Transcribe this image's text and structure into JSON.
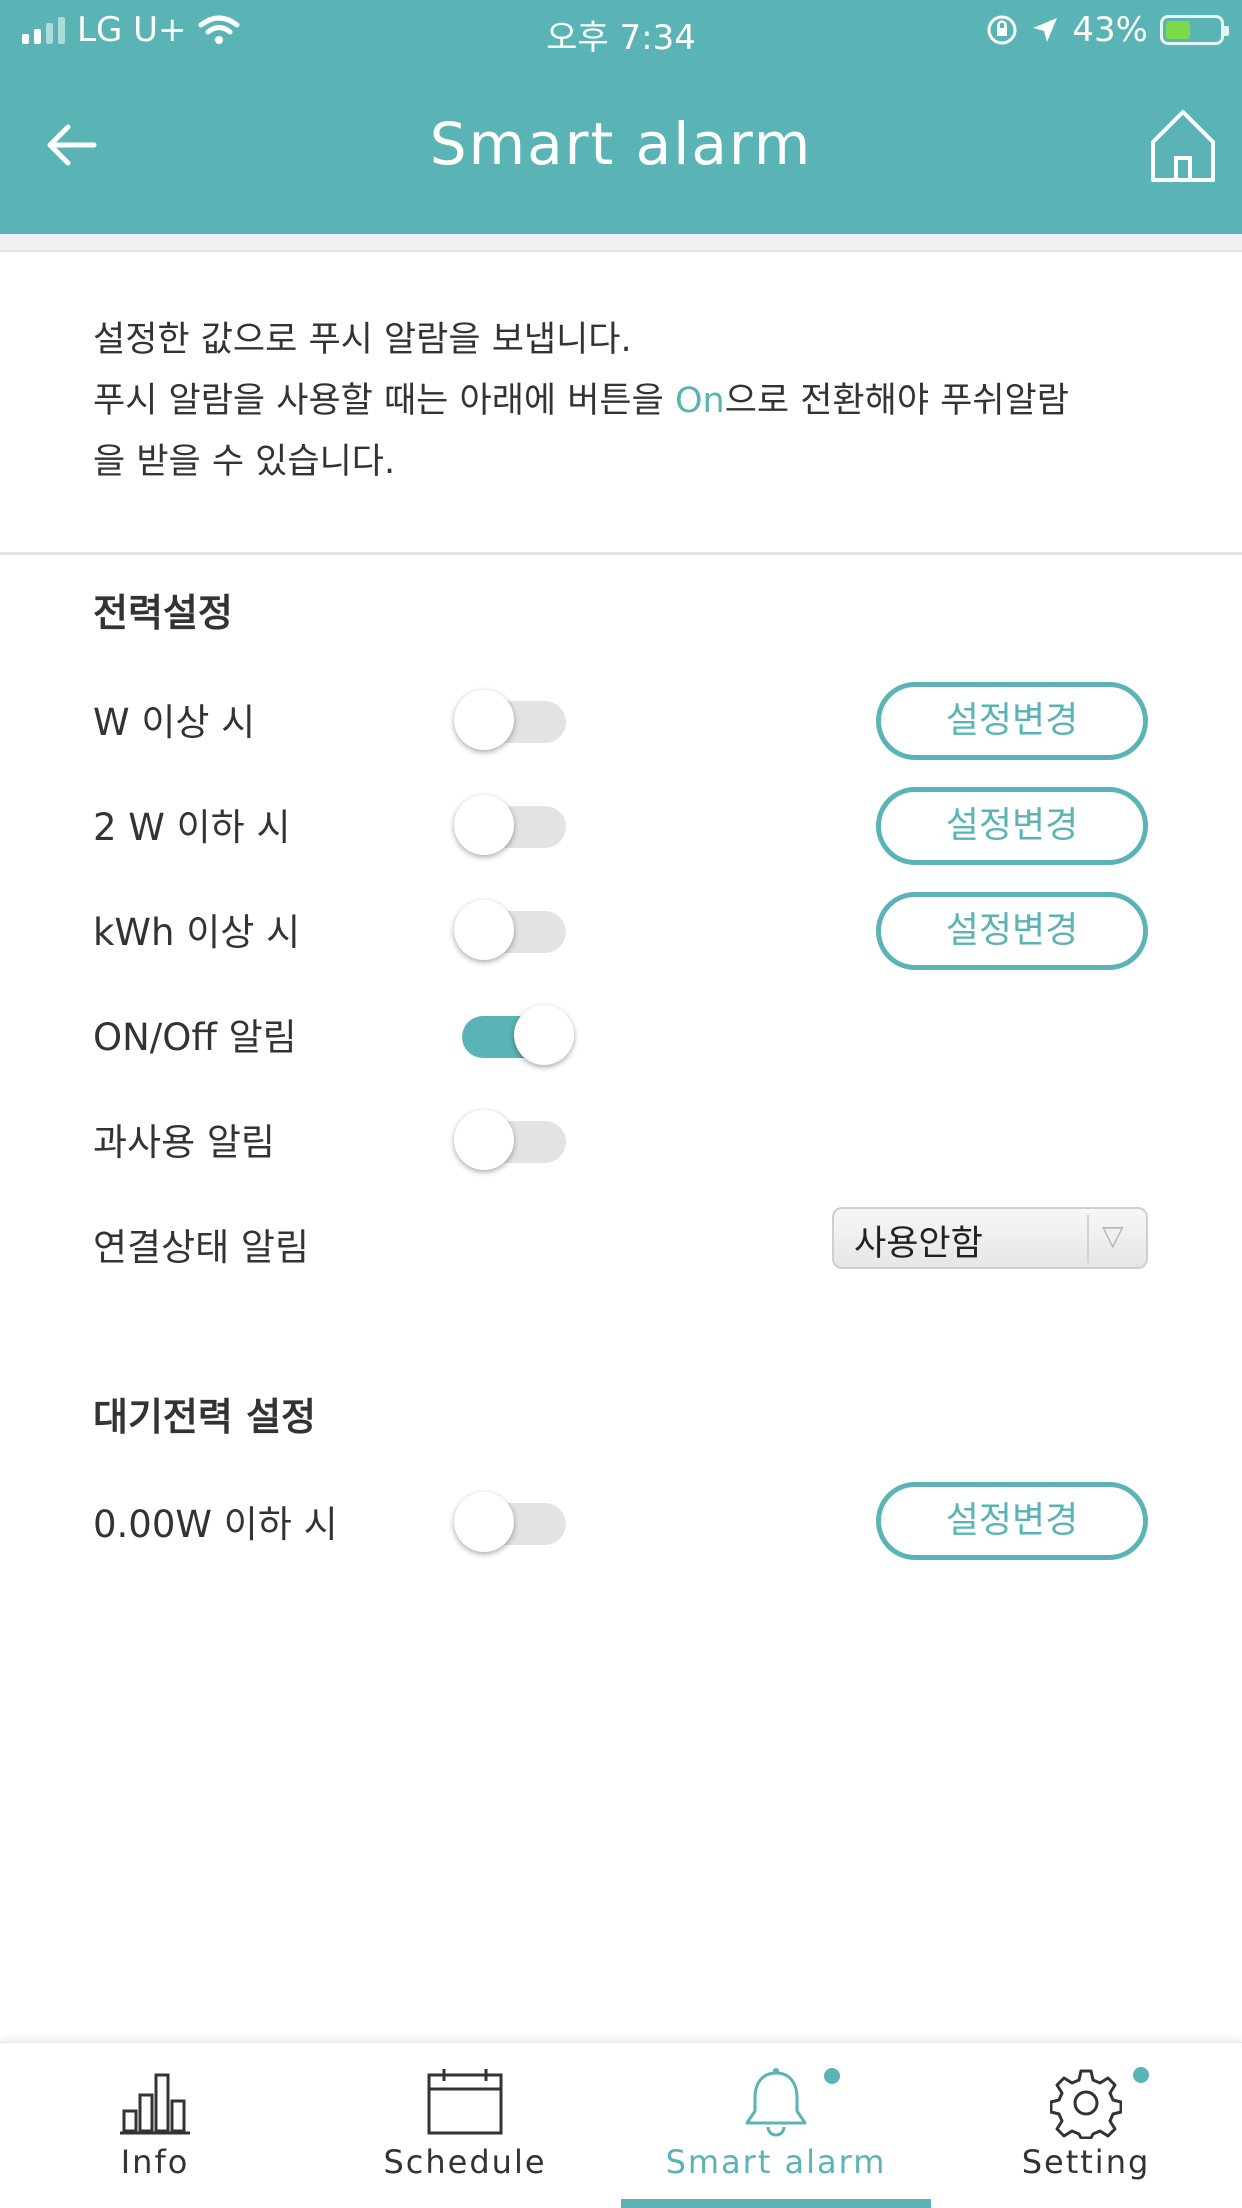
{
  "status_bar": {
    "carrier": "LG U+",
    "time": "오후 7:34",
    "battery": "43%"
  },
  "header": {
    "title": "Smart alarm"
  },
  "intro": {
    "line1": "설정한 값으로 푸시 알람을 보냅니다.",
    "line2_before": "푸시 알람을 사용할 때는 아래에 버튼을 ",
    "line2_highlight": "On",
    "line2_after": "으로 전환해야 푸쉬알람",
    "line3": "을 받을 수 있습니다."
  },
  "power_section": {
    "title": "전력설정",
    "rows": [
      {
        "label": "W 이상 시",
        "toggle_on": false,
        "button": "설정변경"
      },
      {
        "label": "2 W 이하 시",
        "toggle_on": false,
        "button": "설정변경"
      },
      {
        "label": "kWh 이상 시",
        "toggle_on": false,
        "button": "설정변경"
      },
      {
        "label": "ON/Off 알림",
        "toggle_on": true
      },
      {
        "label": "과사용 알림",
        "toggle_on": false
      }
    ],
    "connection": {
      "label": "연결상태 알림",
      "selected": "사용안함"
    }
  },
  "standby_section": {
    "title": "대기전력 설정",
    "row": {
      "label": "0.00W 이하 시",
      "toggle_on": false,
      "button": "설정변경"
    }
  },
  "bottom_nav": {
    "tabs": [
      {
        "label": "Info",
        "icon": "bar-chart-icon",
        "active": false,
        "dot": false
      },
      {
        "label": "Schedule",
        "icon": "calendar-icon",
        "active": false,
        "dot": false
      },
      {
        "label": "Smart alarm",
        "icon": "bell-icon",
        "active": true,
        "dot": true
      },
      {
        "label": "Setting",
        "icon": "gear-icon",
        "active": false,
        "dot": true
      }
    ]
  },
  "colors": {
    "accent": "#5ab4b5",
    "text": "#333333"
  }
}
